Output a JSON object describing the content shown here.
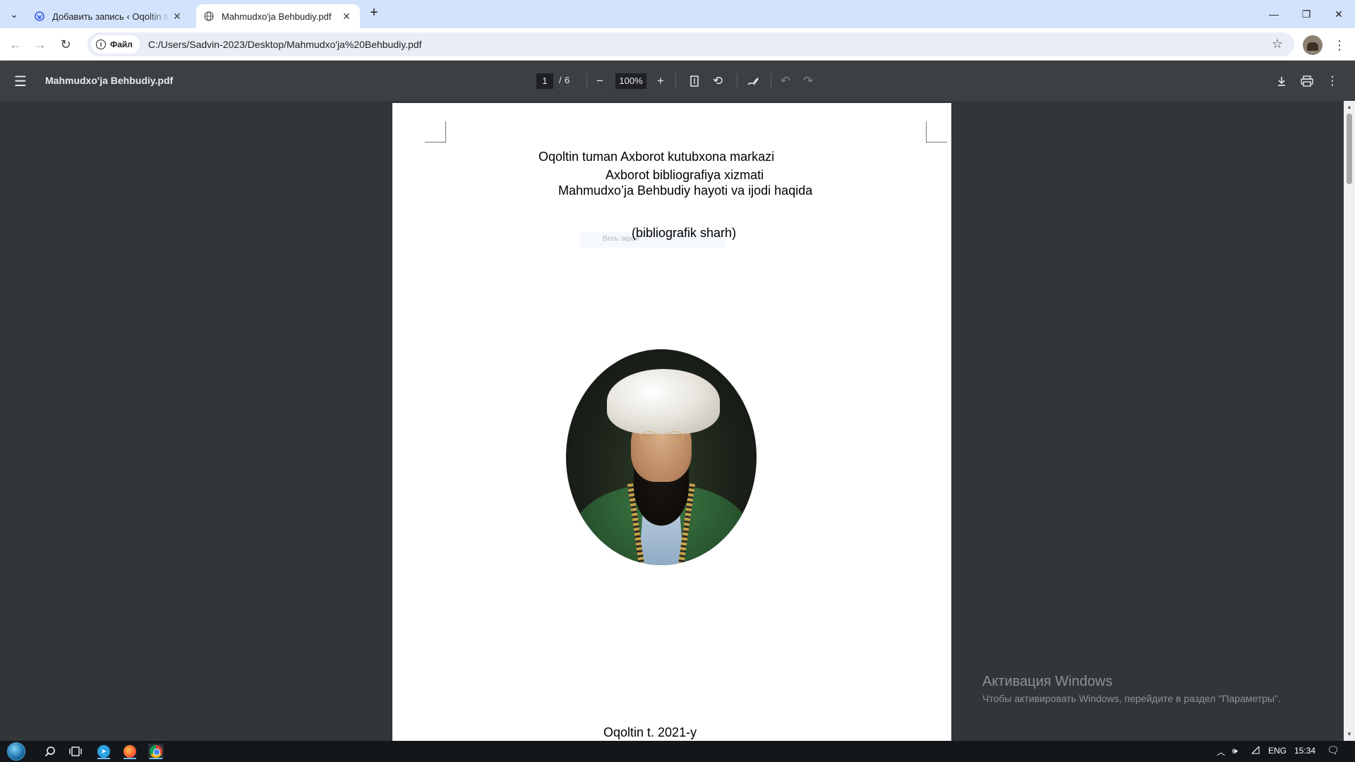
{
  "tabs": [
    {
      "title": "Добавить запись ‹ Oqoltin tuman",
      "favicon": "wordpress-icon",
      "active": false
    },
    {
      "title": "Mahmudxo'ja Behbudiy.pdf",
      "favicon": "globe-icon",
      "active": true
    }
  ],
  "omnibox": {
    "chip_label": "Файл",
    "url": "C:/Users/Sadvin-2023/Desktop/Mahmudxo'ja%20Behbudiy.pdf"
  },
  "pdf_toolbar": {
    "doc_title": "Mahmudxo'ja Behbudiy.pdf",
    "current_page": "1",
    "page_separator": "/",
    "total_pages": "6",
    "zoom": "100%"
  },
  "pdf_page": {
    "line1": "Oqoltin tuman Axborot  kutubxona markazi",
    "line2": "Axborot bibliografiya xizmati",
    "line3": "Mahmudxo’ja Behbudiy hayoti va ijodi  haqida",
    "line4": "(bibliografik  sharh)",
    "faint_text": "Весь экран",
    "footer": "Oqoltin t.  2021-y"
  },
  "watermark": {
    "title": "Активация Windows",
    "subtitle": "Чтобы активировать Windows, перейдите в раздел \"Параметры\"."
  },
  "taskbar": {
    "language": "ENG",
    "time": "15:34"
  },
  "colors": {
    "tabstrip_bg": "#d3e3fd",
    "pdf_toolbar_bg": "#3c4043",
    "viewer_bg": "#323639",
    "taskbar_bg": "#13171c"
  }
}
